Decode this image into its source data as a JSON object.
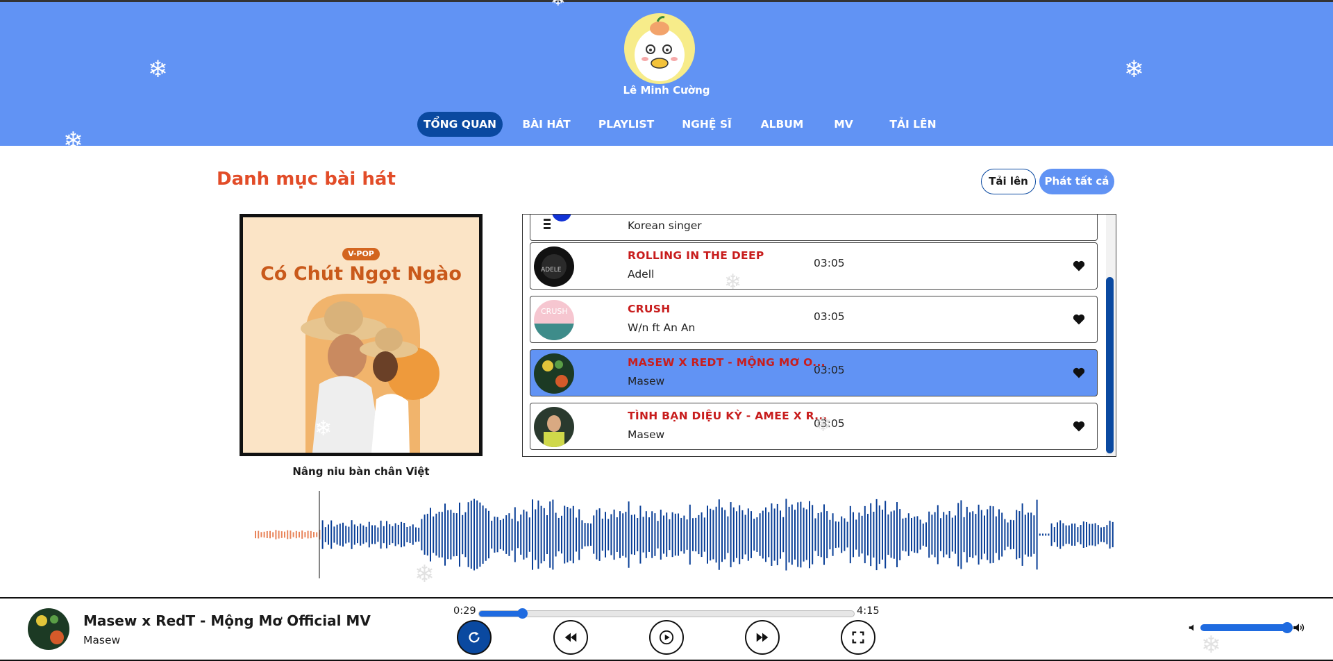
{
  "profile": {
    "name": "Lê Minh Cường"
  },
  "nav": {
    "items": [
      {
        "label": "TỔNG QUAN",
        "active": true
      },
      {
        "label": "BÀI HÁT",
        "active": false
      },
      {
        "label": "PLAYLIST",
        "active": false
      },
      {
        "label": "NGHỆ SĨ",
        "active": false
      },
      {
        "label": "ALBUM",
        "active": false
      },
      {
        "label": "MV",
        "active": false
      },
      {
        "label": "TẢI LÊN",
        "active": false
      }
    ]
  },
  "section": {
    "title": "Danh mục bài hát",
    "upload_label": "Tải lên",
    "play_all_label": "Phát tất cả"
  },
  "album": {
    "badge": "V-POP",
    "cover_title": "Có Chút Ngọt Ngào",
    "caption": "Nâng niu bàn chân Việt"
  },
  "songs": [
    {
      "title": "",
      "artist": "Korean singer",
      "duration": "",
      "active": false,
      "thumb": "korea-flag"
    },
    {
      "title": "ROLLING IN THE DEEP",
      "artist": "Adell",
      "duration": "03:05",
      "active": false,
      "thumb": "adele"
    },
    {
      "title": "CRUSH",
      "artist": "W/n ft An An",
      "duration": "03:05",
      "active": false,
      "thumb": "crush"
    },
    {
      "title": "MASEW X REDT - MỘNG MƠ O...",
      "artist": "Masew",
      "duration": "03:05",
      "active": true,
      "thumb": "mong-mo"
    },
    {
      "title": "TÌNH BẠN DIỆU KỲ - AMEE X R...",
      "artist": "Masew",
      "duration": "03:05",
      "active": false,
      "thumb": "tinh-ban"
    }
  ],
  "player": {
    "title": "Masew x RedT - Mộng Mơ Official MV",
    "artist": "Masew",
    "current_time": "0:29",
    "total_time": "4:15",
    "progress_fraction": 0.114,
    "volume_fraction": 0.99,
    "repeat_active": true
  },
  "colors": {
    "header_bg": "#6193f4",
    "nav_active": "#0a49a0",
    "title_red": "#e24c28",
    "song_title": "#c81d1d",
    "wave_played": "#e8845a",
    "wave_rest": "#0a3f97"
  },
  "icons": [
    "snowflake-icon",
    "heart-icon",
    "repeat-icon",
    "rewind-icon",
    "play-icon",
    "fast-forward-icon",
    "fullscreen-icon",
    "volume-low-icon",
    "volume-high-icon"
  ]
}
